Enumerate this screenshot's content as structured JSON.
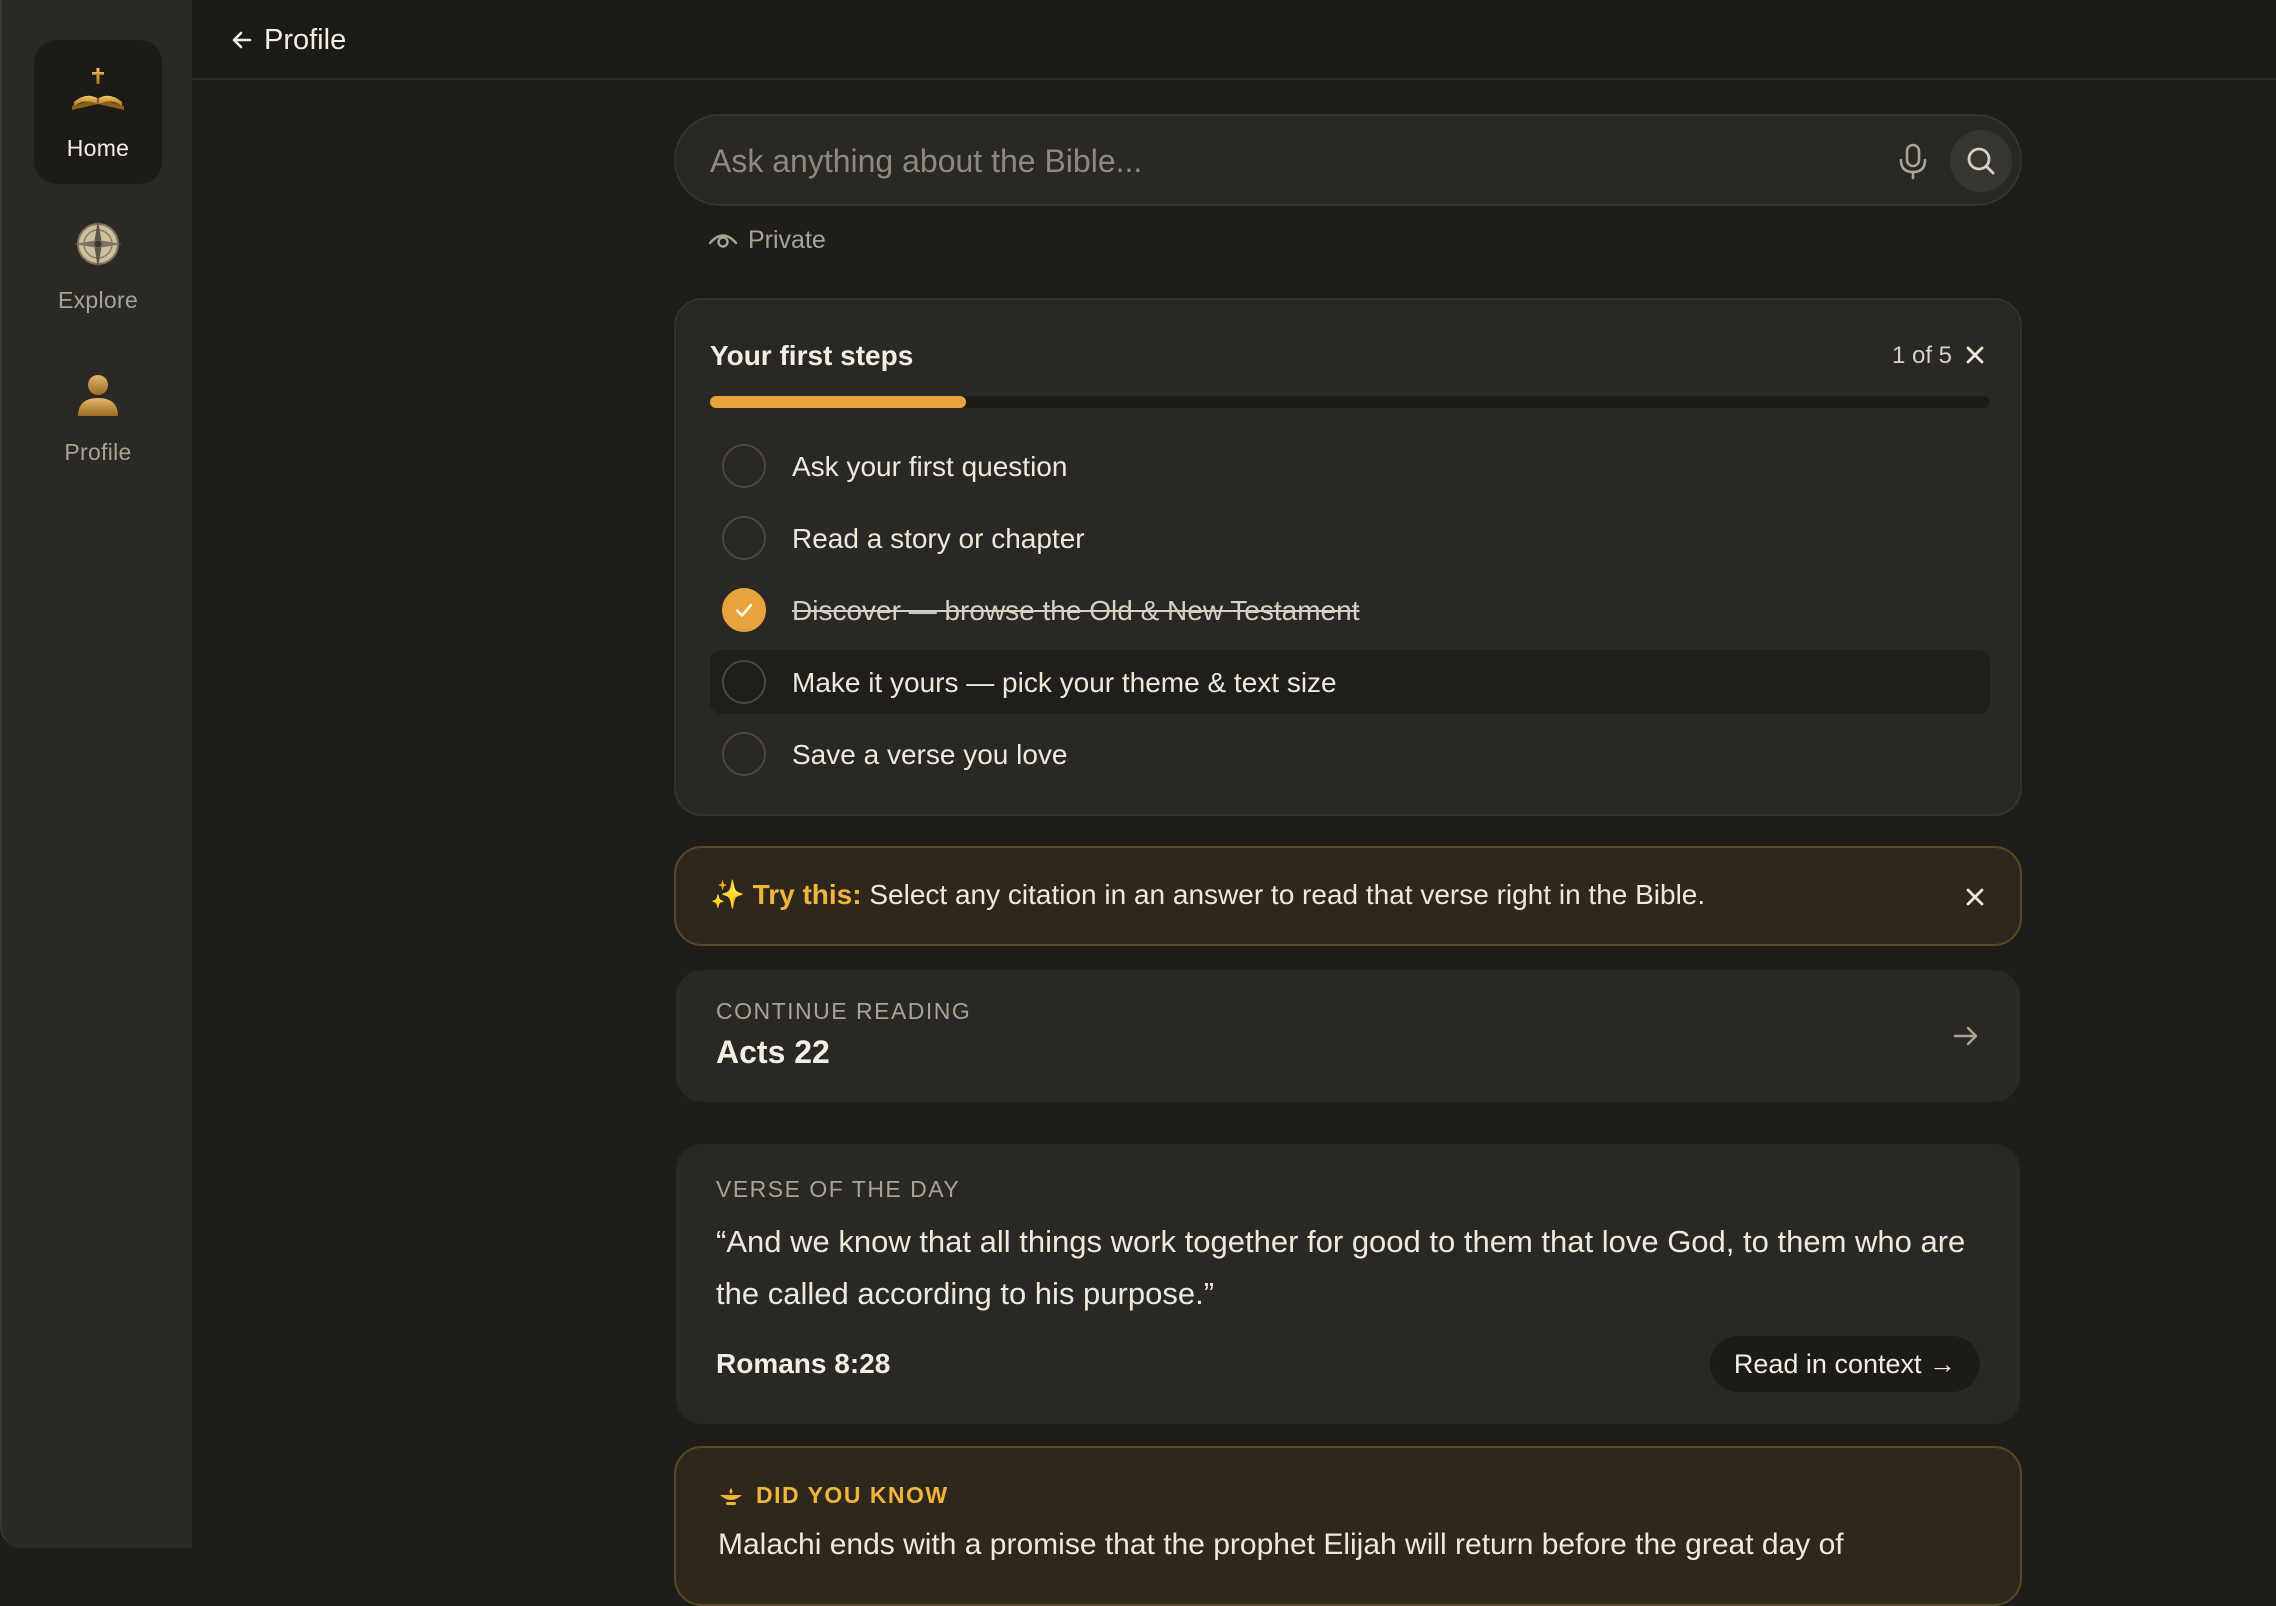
{
  "sidebar": {
    "items": [
      {
        "label": "Home",
        "icon": "open-bible-icon",
        "active": true
      },
      {
        "label": "Explore",
        "icon": "compass-icon",
        "active": false
      },
      {
        "label": "Profile",
        "icon": "person-icon",
        "active": false
      }
    ]
  },
  "topbar": {
    "back_label": "Profile"
  },
  "search": {
    "placeholder": "Ask anything about the Bible...",
    "value": ""
  },
  "privacy": {
    "label": "Private"
  },
  "first_steps": {
    "title": "Your first steps",
    "counter": "1 of 5",
    "progress_fraction": 0.2,
    "steps": [
      {
        "label": "Ask your first question",
        "done": false
      },
      {
        "label": "Read a story or chapter",
        "done": false
      },
      {
        "label": "Discover — browse the Old & New Testament",
        "done": true
      },
      {
        "label": "Make it yours — pick your theme & text size",
        "done": false
      },
      {
        "label": "Save a verse you love",
        "done": false
      }
    ]
  },
  "tip": {
    "emoji": "✨",
    "strong": "Try this:",
    "text": "Select any citation in an answer to read that verse right in the Bible."
  },
  "continue_reading": {
    "eyebrow": "CONTINUE READING",
    "title": "Acts 22"
  },
  "verse_of_day": {
    "eyebrow": "VERSE OF THE DAY",
    "text": "“And we know that all things work together for good to them that love God, to them who are the called according to his purpose.”",
    "reference": "Romans 8:28",
    "button_label": "Read in context →"
  },
  "did_you_know": {
    "title": "DID YOU KNOW",
    "text": "Malachi ends with a promise that the prophet Elijah will return before the great day of"
  },
  "colors": {
    "accent": "#e7a33c",
    "accent_text": "#f1b43d",
    "background": "#1e1d1a",
    "card": "#2a2824",
    "sidebar": "#2b2925"
  }
}
